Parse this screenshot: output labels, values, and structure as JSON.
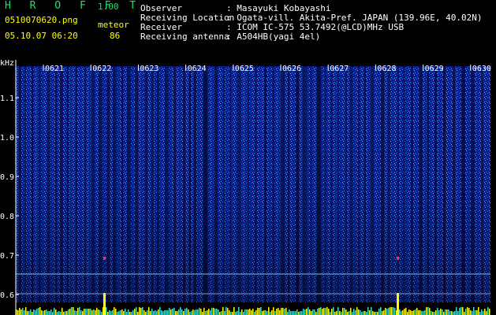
{
  "header": {
    "app_title": "H R O F F T",
    "app_version": "1.00",
    "file_name": "0510070620.png",
    "meteor_label": "meteor",
    "datetime": "05.10.07 06:20",
    "meteor_count": "86"
  },
  "info": [
    {
      "label": "Observer",
      "value": ": Masayuki Kobayashi"
    },
    {
      "label": "Receiving Location",
      "value": ": Ogata-vill. Akita-Pref. JAPAN (139.96E, 40.02N)"
    },
    {
      "label": "Receiver",
      "value": ": ICOM IC-575 53.7492(@LCD)MHz USB"
    },
    {
      "label": "Receiving antenna",
      "value": ": A504HB(yagi 4el)"
    }
  ],
  "chart_data": {
    "type": "heatmap",
    "ylabel": "kHz",
    "y_ticks": [
      "1.1",
      "1.0",
      "0.9",
      "0.8",
      "0.7",
      "0.6"
    ],
    "time_ticks": [
      "0621",
      "0622",
      "0623",
      "0624",
      "0625",
      "0626",
      "0627",
      "0628",
      "0629",
      "0630"
    ],
    "colors": {
      "low": "#0c1e96",
      "mid": "#1e64ff",
      "high": "#46d8c8",
      "peak": "#ffff00",
      "axis": "#ffffff"
    }
  }
}
